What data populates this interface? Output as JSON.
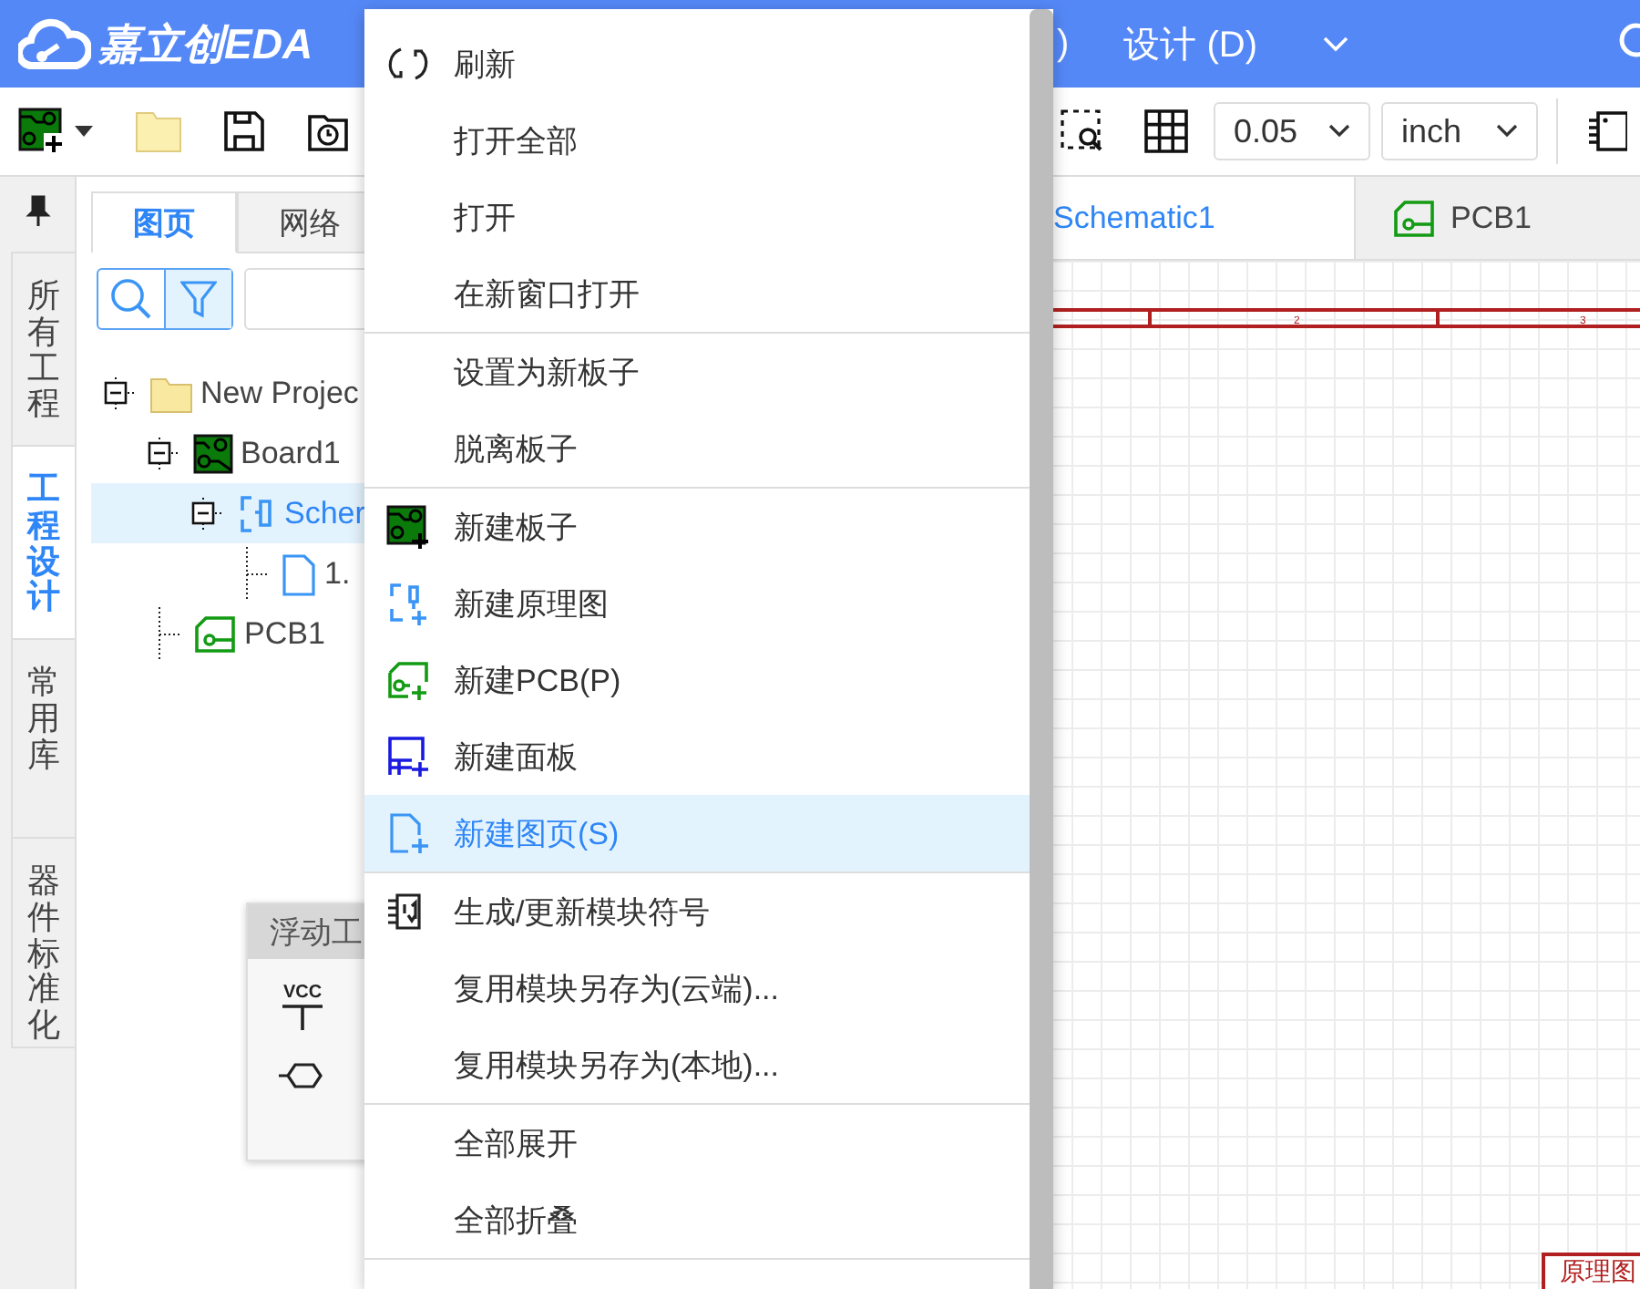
{
  "header": {
    "logo_text": "嘉立创EDA",
    "menus": [
      {
        "label": ")"
      },
      {
        "label": "设计 (D)"
      }
    ]
  },
  "toolbar": {
    "grid_size": "0.05",
    "unit": "inch"
  },
  "left_tabs": [
    {
      "label": "所有工程",
      "selected": false
    },
    {
      "label": "工程设计",
      "selected": true
    },
    {
      "label": "常用库",
      "selected": false
    },
    {
      "label": "器件标准化",
      "selected": false
    }
  ],
  "panel": {
    "tabs": [
      {
        "label": "图页",
        "selected": true
      },
      {
        "label": "网络",
        "selected": false
      }
    ],
    "tree": [
      {
        "label": "New Projec",
        "kind": "folder",
        "selected": false,
        "expanded": true,
        "children": [
          {
            "label": "Board1",
            "kind": "board",
            "selected": false,
            "expanded": true,
            "children": [
              {
                "label": "Scher",
                "kind": "schematic",
                "selected": true,
                "expanded": true,
                "children": [
                  {
                    "label": "1.",
                    "kind": "page",
                    "selected": false
                  }
                ]
              }
            ]
          },
          {
            "label": "PCB1",
            "kind": "pcb",
            "selected": false
          }
        ]
      }
    ]
  },
  "doc_tabs": [
    {
      "label": "Schematic1",
      "selected": true
    },
    {
      "label": "PCB1",
      "kind": "pcb",
      "selected": false
    }
  ],
  "canvas": {
    "ruler_labels": [
      "2",
      "3"
    ],
    "title_block": "原理图"
  },
  "float_toolbar": {
    "title": "浮动工",
    "tools": [
      {
        "kind": "vcc",
        "label": "VCC"
      },
      {
        "kind": "port"
      }
    ]
  },
  "context_menu": {
    "groups": [
      [
        {
          "label": "刷新",
          "kind": "refresh",
          "selected": false
        },
        {
          "label": "打开全部",
          "kind": "none",
          "selected": false
        },
        {
          "label": "打开",
          "kind": "none",
          "selected": false
        },
        {
          "label": "在新窗口打开",
          "kind": "none",
          "selected": false
        }
      ],
      [
        {
          "label": "设置为新板子",
          "kind": "none",
          "selected": false
        },
        {
          "label": "脱离板子",
          "kind": "none",
          "selected": false
        }
      ],
      [
        {
          "label": "新建板子",
          "kind": "board",
          "selected": false
        },
        {
          "label": "新建原理图",
          "kind": "schematic",
          "selected": false
        },
        {
          "label": "新建PCB(P)",
          "kind": "pcb",
          "selected": false
        },
        {
          "label": "新建面板",
          "kind": "panel",
          "selected": false
        },
        {
          "label": "新建图页(S)",
          "kind": "page",
          "selected": true
        }
      ],
      [
        {
          "label": "生成/更新模块符号",
          "kind": "chip",
          "selected": false
        },
        {
          "label": "复用模块另存为(云端)...",
          "kind": "none",
          "selected": false
        },
        {
          "label": "复用模块另存为(本地)...",
          "kind": "none",
          "selected": false
        }
      ],
      [
        {
          "label": "全部展开",
          "kind": "none",
          "selected": false
        },
        {
          "label": "全部折叠",
          "kind": "none",
          "selected": false
        }
      ]
    ]
  }
}
